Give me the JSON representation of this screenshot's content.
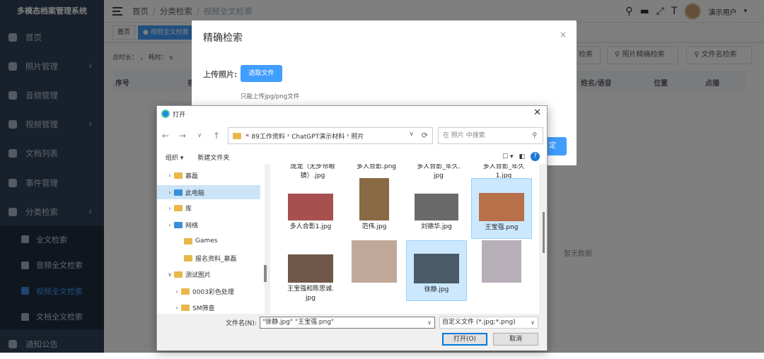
{
  "app_title": "多模态档案管理系统",
  "sidebar": {
    "items": [
      {
        "label": "首页"
      },
      {
        "label": "照片管理",
        "chev": "∨"
      },
      {
        "label": "音频管理"
      },
      {
        "label": "视频管理",
        "chev": "∨"
      },
      {
        "label": "文档列表"
      },
      {
        "label": "事件管理"
      },
      {
        "label": "分类检索",
        "chev": "∧"
      }
    ],
    "subitems": [
      {
        "label": "全文检索"
      },
      {
        "label": "音频全文检索"
      },
      {
        "label": "视频全文检索"
      },
      {
        "label": "文档全文检索"
      }
    ],
    "last": {
      "label": "通知公告"
    }
  },
  "breadcrumb": {
    "home": "首页",
    "sep": "/",
    "cat": "分类检索",
    "current": "视频全文检索"
  },
  "user": {
    "name": "演示用户"
  },
  "header_icons": [
    "search-icon",
    "message-icon",
    "fullscreen-icon",
    "font-size-icon"
  ],
  "tabs": [
    {
      "label": "首页"
    },
    {
      "label": "视频全文检索"
    }
  ],
  "stat": "总时长： ，  耗时： s",
  "search_buttons": {
    "partial": "检索",
    "photo": "照片精确检索",
    "filename": "文件名检索"
  },
  "table": {
    "columns": {
      "index": "序号",
      "partial": "视",
      "name": "姓名/语音",
      "pos": "位置",
      "play": "点播"
    },
    "empty": "暂无数据"
  },
  "modal": {
    "title": "精确检索",
    "close": "×",
    "upload_label": "上传照片:",
    "pick_btn": "选取文件",
    "tip": "只能上传jpg/png文件",
    "confirm_partial": "定"
  },
  "dialog": {
    "title": "打开",
    "close": "✕",
    "path": [
      "«",
      "89工作资料",
      "›",
      "ChatGPT演示材料",
      "›",
      "照片"
    ],
    "search_placeholder": "在 照片 中搜索",
    "organize": "组织 ▾",
    "new_folder": "新建文件夹",
    "tree": [
      {
        "label": "慕磊",
        "arrow": "›",
        "kind": "folder"
      },
      {
        "label": "此电脑",
        "arrow": "›",
        "kind": "pc",
        "selected": true
      },
      {
        "label": "库",
        "arrow": "›",
        "kind": "folder"
      },
      {
        "label": "网络",
        "arrow": "›",
        "kind": "pc"
      },
      {
        "label": "Games",
        "arrow": "",
        "kind": "folder"
      },
      {
        "label": "报名资料_慕磊",
        "arrow": "",
        "kind": "folder"
      },
      {
        "label": "测试图片",
        "arrow": "∨",
        "kind": "folder"
      },
      {
        "label": "0003彩色处理",
        "arrow": "›",
        "kind": "folder"
      },
      {
        "label": "SM筛查",
        "arrow": "›",
        "kind": "folder"
      }
    ],
    "files_top": [
      {
        "l1": "庞龙（无步帘眼",
        "l2": "镜）.jpg"
      },
      {
        "l1": "多人合影.png",
        "l2": ""
      },
      {
        "l1": "多人合影_年久.",
        "l2": "jpg"
      },
      {
        "l1": "多人合影_年久",
        "l2": "1.jpg"
      }
    ],
    "files_row1": [
      {
        "l1": "多人合影1.jpg",
        "l2": "",
        "selected": false,
        "color": "#a85050"
      },
      {
        "l1": "范伟.jpg",
        "l2": "",
        "selected": false,
        "color": "#8a6a44"
      },
      {
        "l1": "刘德华.jpg",
        "l2": "",
        "selected": false,
        "color": "#6a6a6a"
      },
      {
        "l1": "王宝强.png",
        "l2": "",
        "selected": true,
        "color": "#b8704a"
      }
    ],
    "files_row2": [
      {
        "l1": "王宝强和陈思诚.",
        "l2": "jpg",
        "selected": false,
        "color": "#705848"
      },
      {
        "l1": "",
        "l2": "",
        "selected": false,
        "color": "#c0a898"
      },
      {
        "l1": "徐静.jpg",
        "l2": "",
        "selected": true,
        "color": "#4a5a68"
      },
      {
        "l1": "",
        "l2": "",
        "selected": false,
        "color": "#b8b0b8"
      }
    ],
    "filename_label": "文件名(N):",
    "filename_value": "\"徐静.jpg\" \"王宝强.png\"",
    "filetype": "自定义文件 (*.jpg;*.png)",
    "open_btn": "打开(O)",
    "cancel_btn": "取消"
  }
}
